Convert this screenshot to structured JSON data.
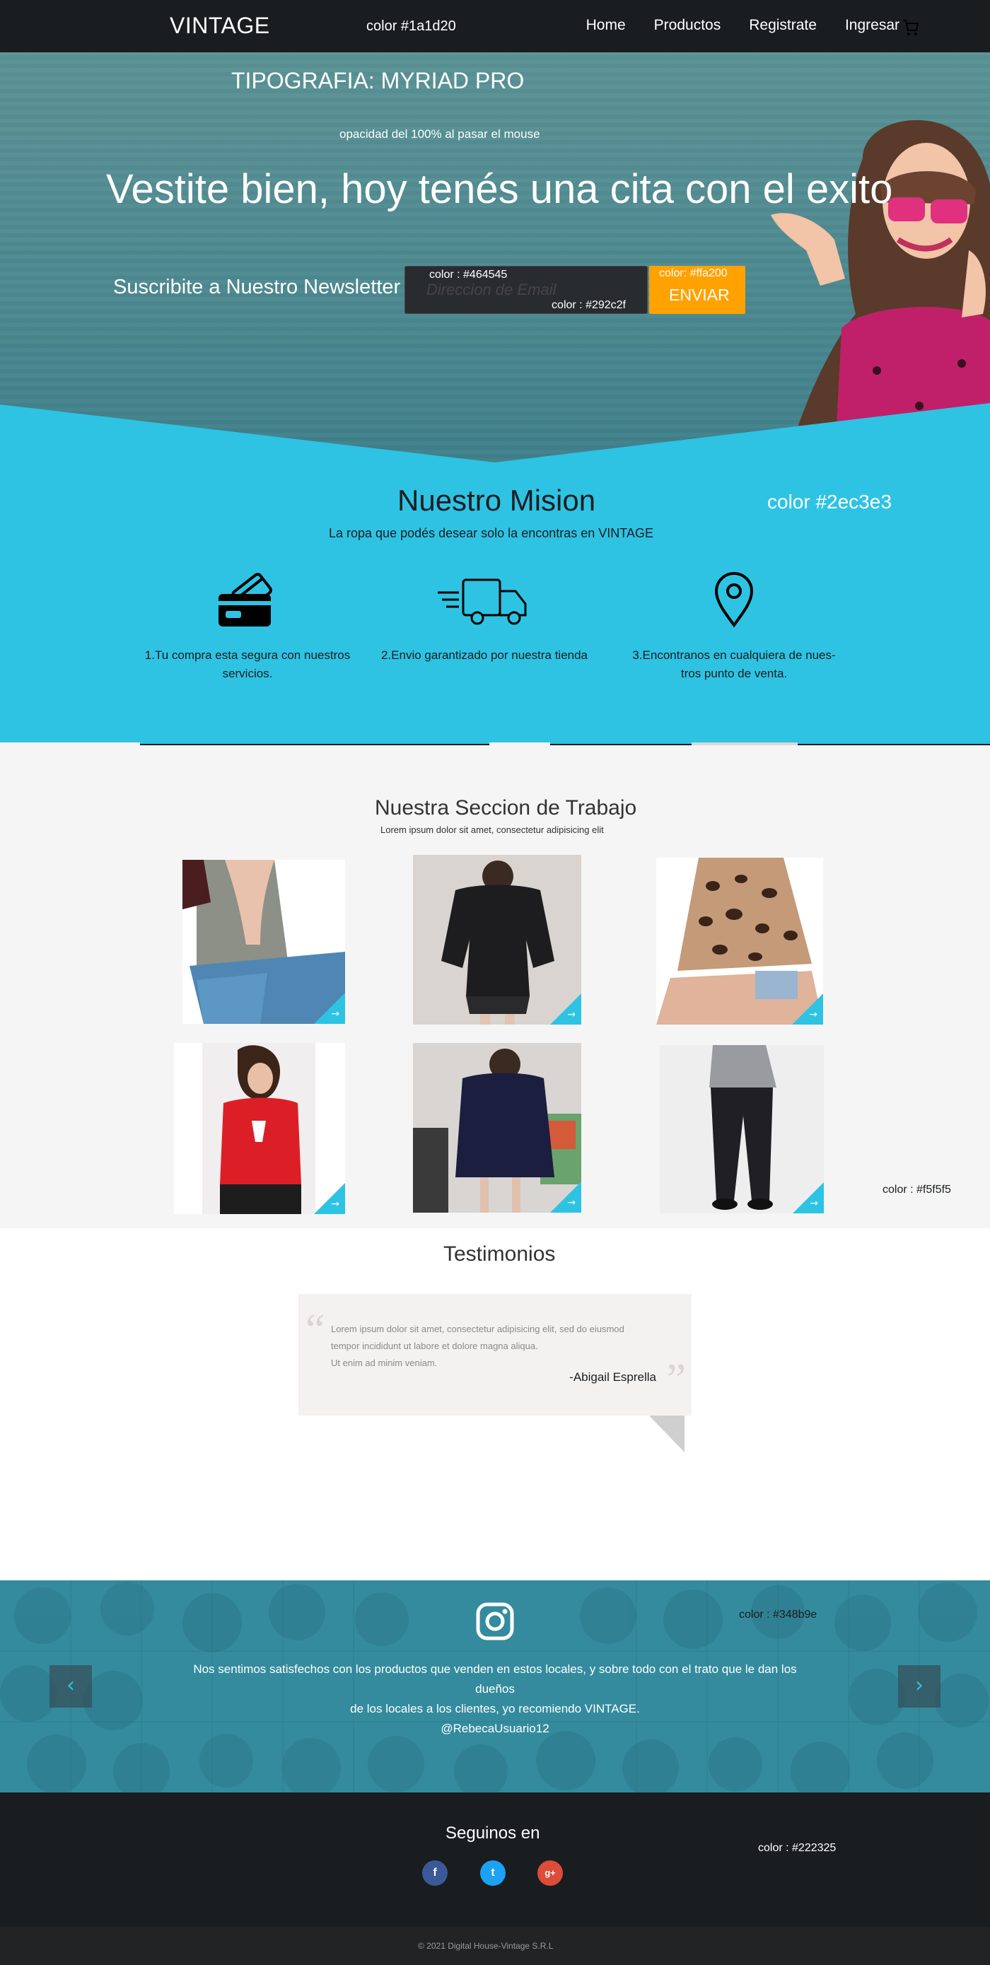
{
  "nav": {
    "brand": "VINTAGE",
    "color_note": "color #1a1d20",
    "links": [
      "Home",
      "Productos",
      "Registrate",
      "Ingresar"
    ],
    "cart_icon": "cart-icon"
  },
  "hero": {
    "typography_note": "TIPOGRAFIA: MYRIAD PRO",
    "opacity_note": "opacidad del 100% al pasar el mouse",
    "headline": "Vestite bien, hoy tenés una cita con el exito",
    "newsletter_label": "Suscribite a Nuestro Newsletter",
    "email_placeholder": "Direccion de Email",
    "email_border_note": "color : #464545",
    "email_bg_note": "color : #292c2f",
    "button_color_note": "color: #ffa200",
    "button_label": "ENVIAR"
  },
  "mission": {
    "title": "Nuestro Mision",
    "color_note": "color #2ec3e3",
    "subtitle": "La ropa que podés desear solo la encontras en VINTAGE",
    "features": [
      {
        "icon": "credit-card-icon",
        "text": "1.Tu compra esta segura con nuestros servicios."
      },
      {
        "icon": "delivery-truck-icon",
        "text": "2.Envio garantizado por nuestra tienda"
      },
      {
        "icon": "location-pin-icon",
        "text": "3.Encontranos en cualquiera de nues-tros punto de venta."
      }
    ]
  },
  "work": {
    "title": "Nuestra Seccion de Trabajo",
    "subtitle": "Lorem ipsum dolor sit amet, consectetur adipisicing elit",
    "color_note": "color : #f5f5f5",
    "products": [
      "grey-blouse-jeans",
      "black-belted-sweater",
      "leopard-print-sweater",
      "red-reindeer-sweater",
      "navy-hoodie-dress",
      "grey-top-black-jeans"
    ],
    "tile_arrow": "→"
  },
  "testimonials": {
    "title": "Testimonios",
    "quote": "Lorem ipsum dolor sit amet, consectetur adipisicing elit, sed do eiusmod tempor incididunt ut labore et dolore magna aliqua. Ut enim ad minim veniam.",
    "quote_lines": [
      "Lorem ipsum dolor sit amet, consectetur adipisicing elit, sed do eiusmod",
      "tempor incididunt ut labore et dolore magna aliqua.",
      "Ut enim ad minim veniam."
    ],
    "author": "-Abigail Esprella",
    "open_quote": "“",
    "close_quote": "”"
  },
  "instagram": {
    "icon": "instagram-icon",
    "color_note": "color : #348b9e",
    "message_line1": "Nos sentimos satisfechos con los productos que venden en estos locales, y sobre todo con el trato que le dan los dueños",
    "message_line2": "de los locales a los clientes, yo recomiendo VINTAGE.",
    "handle": "@RebecaUsuario12",
    "prev": "‹",
    "next": "›"
  },
  "footer": {
    "follow_label": "Seguinos en",
    "color_note": "color : #222325",
    "social": [
      {
        "name": "facebook-icon",
        "glyph": "f",
        "color": "#3b5998"
      },
      {
        "name": "twitter-icon",
        "glyph": "t",
        "color": "#1da1f2"
      },
      {
        "name": "google-plus-icon",
        "glyph": "g+",
        "color": "#dd4b39"
      }
    ],
    "copyright": "© 2021 Digital House-Vintage S.R.L"
  },
  "colors": {
    "nav": "#1a1d20",
    "accent_blue": "#2ec3e3",
    "accent_orange": "#ffa200",
    "input_bg": "#292c2f",
    "input_border": "#464545",
    "work_bg": "#f5f5f5",
    "insta_bg": "#348b9e",
    "footer_bottom": "#222325"
  }
}
